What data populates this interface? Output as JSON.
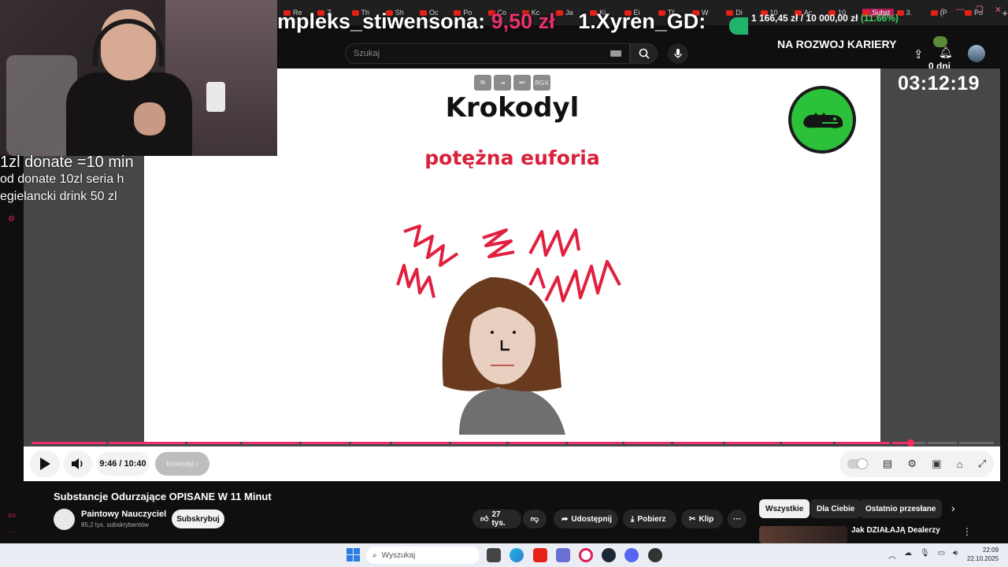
{
  "browser": {
    "tabs": [
      "Re",
      "Z",
      "Th",
      "Sh",
      "Oc",
      "Po",
      "Co",
      "Kc",
      "Ja",
      "Ki",
      "Ei",
      "Tř",
      "W",
      "Di",
      "10",
      "Ac",
      "10",
      "Subst",
      "3.",
      "(P",
      "Po"
    ],
    "add_tab": "+"
  },
  "overlay": {
    "ticker_name": "mpleks_stiwensona:",
    "ticker_amount": "9,50 zł",
    "ticker_next": "1.Xyren_GD:",
    "goal_current": "1 166,45 zł",
    "goal_sep": "/",
    "goal_target": "10 000,00 zł",
    "goal_pct": "(11.66%)",
    "goal_caption": "NA ROZWOJ KARIERY",
    "days": "0 dni",
    "timer": "03:12:19",
    "info_line1": "1zl donate =10 min",
    "info_line2": "od donate 10zl seria h",
    "info_line3": "egielancki drink 50 zl"
  },
  "youtube": {
    "search_placeholder": "Szukaj",
    "slide_title": "Krokodyl",
    "slide_subtitle": "potężna euforia",
    "mini_controls": [
      "⧉",
      "⇥",
      "⏭",
      "RGX"
    ],
    "progress": 0.915,
    "time": "9:46 / 10:40",
    "chapter": "Krokodyl",
    "video_title": "Substancje Odurzające OPISANE W 11 Minut",
    "channel_name": "Paintowy Nauczyciel",
    "channel_subs": "85,2 tys. subskrybentów",
    "subscribe_label": "Subskrybuj",
    "like_count": "27 tys.",
    "share_label": "Udostępnij",
    "download_label": "Pobierz",
    "clip_label": "Klip",
    "chips": [
      "Wszystkie",
      "Dla Ciebie",
      "Ostatnio przesłane"
    ],
    "rec_title": "Jak DZIAŁAJĄ Dealerzy"
  },
  "taskbar": {
    "search_placeholder": "Wyszukaj",
    "time": "22:09",
    "date": "22.10.2025"
  },
  "colors": {
    "accent": "#e8336a",
    "slide_red": "#d8203c",
    "logo_green": "#2cc13a",
    "goal_green": "#3dd15f"
  }
}
